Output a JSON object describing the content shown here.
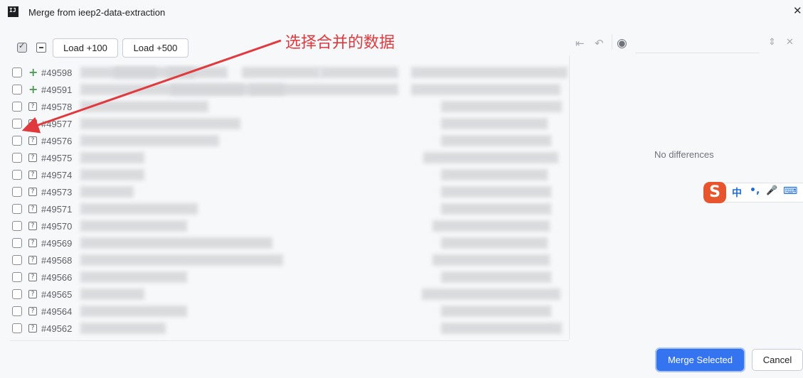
{
  "window": {
    "title": "Merge from ieep2-data-extraction",
    "app_icon_text": "IJ"
  },
  "toolbar": {
    "load100_label": "Load +100",
    "load500_label": "Load +500"
  },
  "annotation": {
    "text": "选择合并的数据",
    "color": "#e0393e"
  },
  "commits": [
    {
      "id": "#49598",
      "status": "added"
    },
    {
      "id": "#49591",
      "status": "added"
    },
    {
      "id": "#49578",
      "status": "unknown"
    },
    {
      "id": "#49577",
      "status": "unknown"
    },
    {
      "id": "#49576",
      "status": "unknown"
    },
    {
      "id": "#49575",
      "status": "unknown"
    },
    {
      "id": "#49574",
      "status": "unknown"
    },
    {
      "id": "#49573",
      "status": "unknown"
    },
    {
      "id": "#49571",
      "status": "unknown"
    },
    {
      "id": "#49570",
      "status": "unknown"
    },
    {
      "id": "#49569",
      "status": "unknown"
    },
    {
      "id": "#49568",
      "status": "unknown"
    },
    {
      "id": "#49566",
      "status": "unknown"
    },
    {
      "id": "#49565",
      "status": "unknown"
    },
    {
      "id": "#49564",
      "status": "unknown"
    },
    {
      "id": "#49562",
      "status": "unknown"
    }
  ],
  "diff_panel": {
    "message": "No differences"
  },
  "ime": {
    "logo": "S",
    "lang": "中",
    "punct": "•,",
    "mic": "🎤",
    "kbd": "⌨"
  },
  "footer": {
    "merge_label": "Merge Selected",
    "cancel_label": "Cancel"
  },
  "colors": {
    "primary": "#3574f0",
    "added": "#4f9c55",
    "annotation": "#e0393e"
  }
}
